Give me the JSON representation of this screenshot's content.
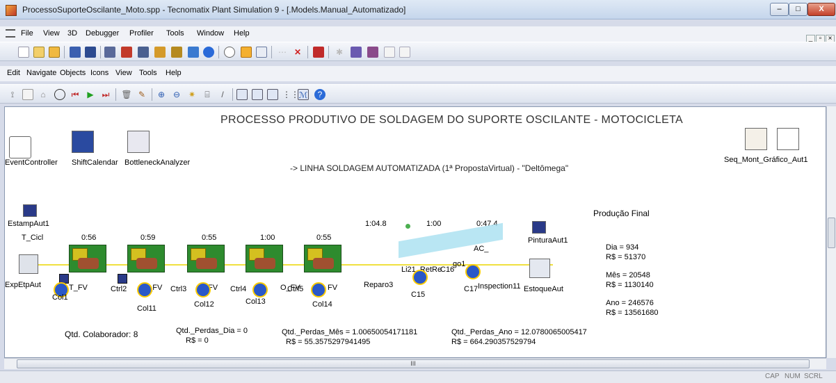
{
  "window": {
    "title": "ProcessoSuporteOscilante_Moto.spp - Tecnomatix Plant Simulation 9 - [.Models.Manual_Automatizado]",
    "btn_min": "–",
    "btn_max": "□",
    "btn_close": "X"
  },
  "menu1": [
    "File",
    "View",
    "3D",
    "Debugger",
    "Profiler",
    "Tools",
    "Window",
    "Help"
  ],
  "menu2": [
    "Edit",
    "Navigate",
    "Objects",
    "Icons",
    "View",
    "Tools",
    "Help"
  ],
  "canvas": {
    "title": "PROCESSO PRODUTIVO DE SOLDAGEM DO SUPORTE OSCILANTE - MOTOCICLETA",
    "subtitle": "-> LINHA SOLDAGEM AUTOMATIZADA (1ª PropostaVirtual) - \"Deltômega\"",
    "top_objects": {
      "event_controller": "EventController",
      "shift_calendar": "ShiftCalendar",
      "bottleneck_analyzer": "BottleneckAnalyzer",
      "seq_mont": "Seq_Mont_Gráfico_Aut1"
    },
    "labels": {
      "estamp": "EstampAut1",
      "t_cicl": "T_Cicl",
      "exp": "ExpEtpAut",
      "pintura": "PinturaAut1",
      "estoque": "EstoqueAut",
      "reparo": "Reparo3",
      "c15": "C15",
      "c17": "C17",
      "inspection": "Inspection11",
      "ac": "AC_",
      "i21": "Li21_RetRe",
      "c16": "C16",
      "go": "go1"
    },
    "cycle_times": [
      "0:56",
      "0:59",
      "0:55",
      "1:00",
      "0:55"
    ],
    "top_times": [
      "1:04.8",
      "1:00",
      "0:47.4"
    ],
    "stations": [
      "T_FV",
      "L_FV",
      "FV",
      "O_FV",
      "FV"
    ],
    "ctrls": [
      "Ctrl2",
      "Ctrl3",
      "Ctrl4",
      "Ctrl5"
    ],
    "cols": [
      "Col1",
      "Col11",
      "Col12",
      "Col13",
      "Col14"
    ],
    "producao": {
      "heading": "Produção Final",
      "dia": "Dia = 934",
      "dia_rs": "R$ = 51370",
      "mes": "Mês = 20548",
      "mes_rs": "R$ = 1130140",
      "ano": "Ano = 246576",
      "ano_rs": "R$ = 13561680"
    },
    "bottom": {
      "colaborador": "Qtd. Colaborador: 8",
      "perdas_dia": "Qtd._Perdas_Dia = 0",
      "perdas_dia_rs": "R$ = 0",
      "perdas_mes": "Qtd._Perdas_Mês = 1.00650054171181",
      "perdas_mes_rs": "R$ = 55.3575297941495",
      "perdas_ano": "Qtd._Perdas_Ano = 12.0780065005417",
      "perdas_ano_rs": "R$ = 664.290357529794"
    }
  },
  "hscroll_label": "III",
  "status": [
    "CAP",
    "NUM",
    "SCRL"
  ]
}
